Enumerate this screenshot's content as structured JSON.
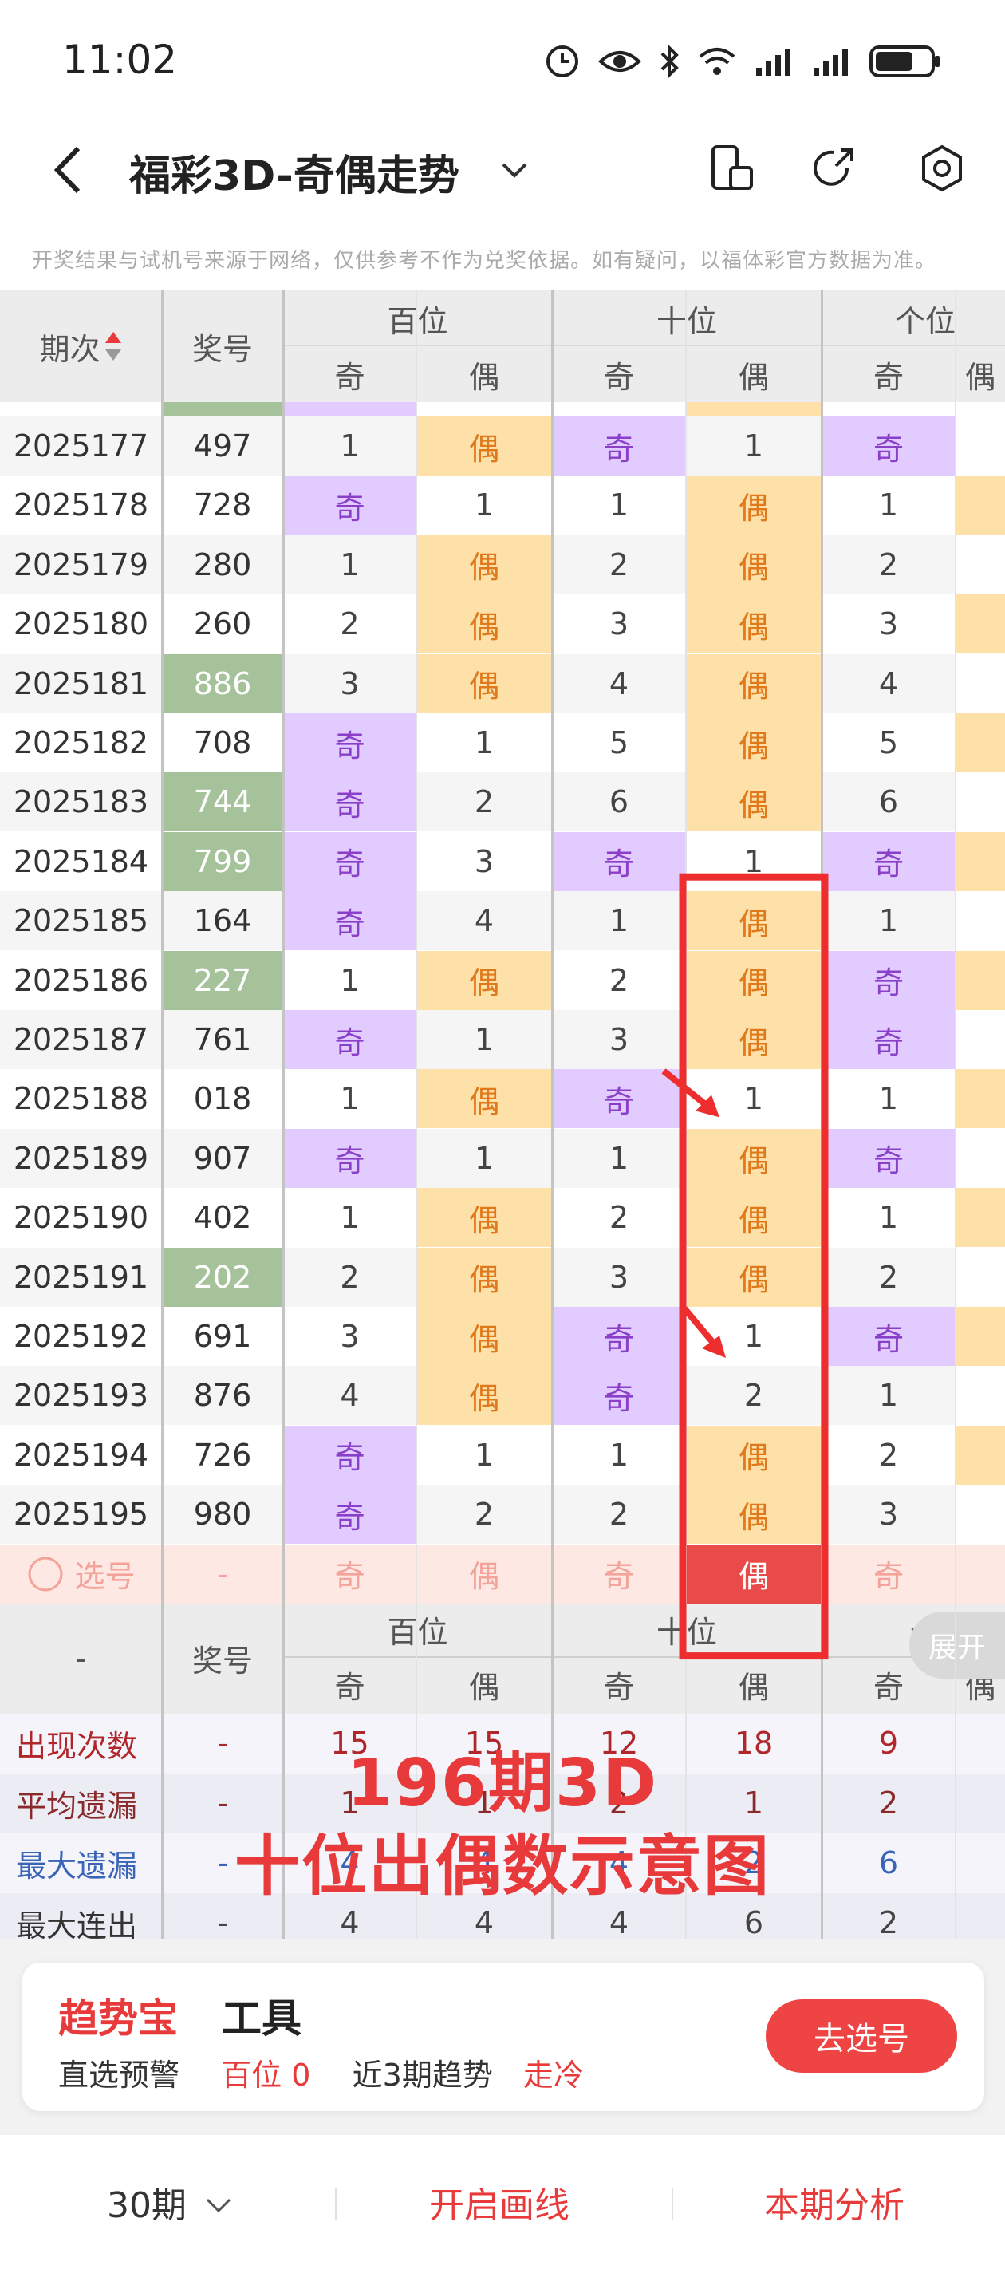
{
  "status_bar": {
    "time": "11:02"
  },
  "header": {
    "title": "福彩3D-奇偶走势"
  },
  "notice": "开奖结果与试机号来源于网络，仅供参考不作为兑奖依据。如有疑问，以福体彩官方数据为准。",
  "table": {
    "col_period": "期次",
    "col_number": "奖号",
    "groups": [
      "百位",
      "十位",
      "个位"
    ],
    "odd": "奇",
    "even": "偶",
    "rows": [
      {
        "period": "2025177",
        "number": "497",
        "green": false,
        "cells": [
          "1",
          "偶",
          "奇",
          "1",
          "奇"
        ]
      },
      {
        "period": "2025178",
        "number": "728",
        "green": false,
        "cells": [
          "奇",
          "1",
          "1",
          "偶",
          "1"
        ]
      },
      {
        "period": "2025179",
        "number": "280",
        "green": false,
        "cells": [
          "1",
          "偶",
          "2",
          "偶",
          "2"
        ]
      },
      {
        "period": "2025180",
        "number": "260",
        "green": false,
        "cells": [
          "2",
          "偶",
          "3",
          "偶",
          "3"
        ]
      },
      {
        "period": "2025181",
        "number": "886",
        "green": true,
        "cells": [
          "3",
          "偶",
          "4",
          "偶",
          "4"
        ]
      },
      {
        "period": "2025182",
        "number": "708",
        "green": false,
        "cells": [
          "奇",
          "1",
          "5",
          "偶",
          "5"
        ]
      },
      {
        "period": "2025183",
        "number": "744",
        "green": true,
        "cells": [
          "奇",
          "2",
          "6",
          "偶",
          "6"
        ]
      },
      {
        "period": "2025184",
        "number": "799",
        "green": true,
        "cells": [
          "奇",
          "3",
          "奇",
          "1",
          "奇"
        ]
      },
      {
        "period": "2025185",
        "number": "164",
        "green": false,
        "cells": [
          "奇",
          "4",
          "1",
          "偶",
          "1"
        ]
      },
      {
        "period": "2025186",
        "number": "227",
        "green": true,
        "cells": [
          "1",
          "偶",
          "2",
          "偶",
          "奇"
        ]
      },
      {
        "period": "2025187",
        "number": "761",
        "green": false,
        "cells": [
          "奇",
          "1",
          "3",
          "偶",
          "奇"
        ]
      },
      {
        "period": "2025188",
        "number": "018",
        "green": false,
        "cells": [
          "1",
          "偶",
          "奇",
          "1",
          "1"
        ]
      },
      {
        "period": "2025189",
        "number": "907",
        "green": false,
        "cells": [
          "奇",
          "1",
          "1",
          "偶",
          "奇"
        ]
      },
      {
        "period": "2025190",
        "number": "402",
        "green": false,
        "cells": [
          "1",
          "偶",
          "2",
          "偶",
          "1"
        ]
      },
      {
        "period": "2025191",
        "number": "202",
        "green": true,
        "cells": [
          "2",
          "偶",
          "3",
          "偶",
          "2"
        ]
      },
      {
        "period": "2025192",
        "number": "691",
        "green": false,
        "cells": [
          "3",
          "偶",
          "奇",
          "1",
          "奇"
        ]
      },
      {
        "period": "2025193",
        "number": "876",
        "green": false,
        "cells": [
          "4",
          "偶",
          "奇",
          "2",
          "1"
        ]
      },
      {
        "period": "2025194",
        "number": "726",
        "green": false,
        "cells": [
          "奇",
          "1",
          "1",
          "偶",
          "2"
        ]
      },
      {
        "period": "2025195",
        "number": "980",
        "green": false,
        "cells": [
          "奇",
          "2",
          "2",
          "偶",
          "3"
        ]
      }
    ],
    "select_row": {
      "label": "选号",
      "number": "-",
      "cells": [
        "奇",
        "偶",
        "奇",
        "偶",
        "奇"
      ]
    }
  },
  "stats": {
    "left_label": "-",
    "col_number": "奖号",
    "groups": [
      "百位",
      "十位",
      "个"
    ],
    "rows": [
      {
        "label": "出现次数",
        "color": "#b0262a",
        "number": "-",
        "values": [
          "15",
          "15",
          "12",
          "18",
          "9"
        ]
      },
      {
        "label": "平均遗漏",
        "color": "#8a2a2a",
        "number": "-",
        "values": [
          "1",
          "1",
          "2",
          "1",
          "2"
        ]
      },
      {
        "label": "最大遗漏",
        "color": "#3a64b8",
        "number": "-",
        "values": [
          "4",
          "4",
          "4",
          "2",
          "6"
        ]
      },
      {
        "label": "最大连出",
        "color": "#333333",
        "number": "-",
        "values": [
          "4",
          "4",
          "4",
          "6",
          "2"
        ]
      }
    ],
    "value_colors": [
      "#b0262a",
      "#8a2a2a",
      "#3a64b8",
      "#444444"
    ]
  },
  "expand_label": "展开",
  "overlay": {
    "line1": "196期3D",
    "line2": "十位出偶数示意图"
  },
  "tool_card": {
    "brand": "趋势宝",
    "brand_suffix": "工具",
    "label1": "直选预警",
    "value1": "百位 0",
    "label2": "近3期趋势",
    "value2": "走冷",
    "button": "去选号"
  },
  "bottom_bar": {
    "periods": "30期",
    "draw": "开启画线",
    "analysis": "本期分析"
  },
  "colors": {
    "accent": "#e83a3a",
    "odd_bg": "#e2ccff",
    "even_bg": "#fde1a9",
    "green": "#a5c29b"
  }
}
